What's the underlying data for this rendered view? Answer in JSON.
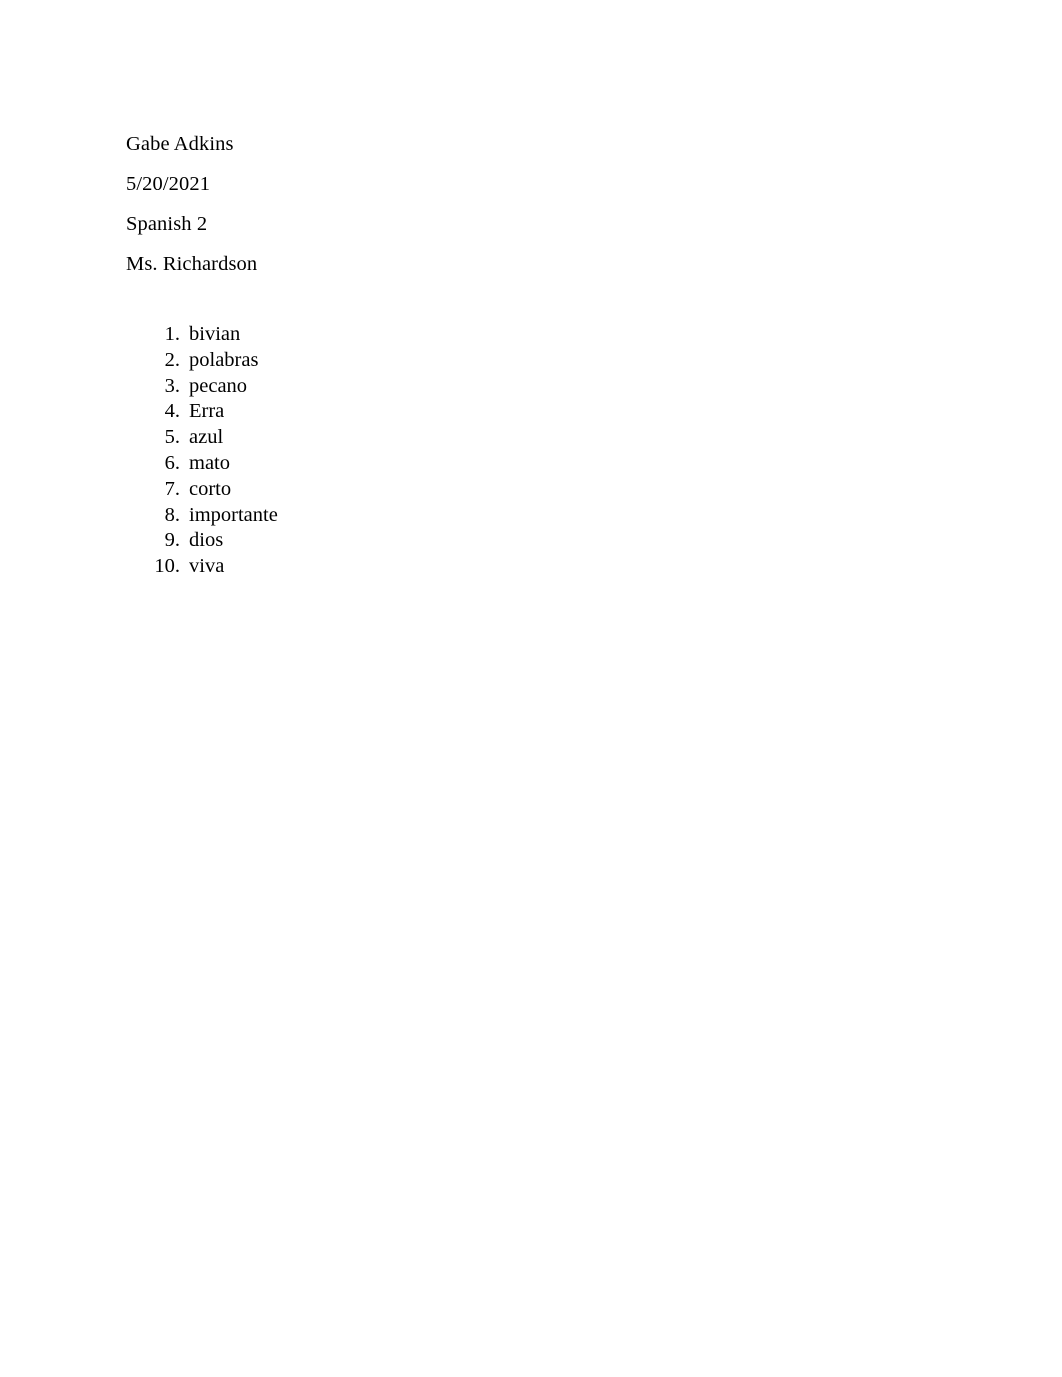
{
  "document": {
    "page_background": "#ffffff",
    "text_color": "#000000",
    "heading": {
      "lines": [
        {
          "text": "Gabe Adkins",
          "role": "student-name"
        },
        {
          "text": "5/20/2021",
          "role": "date"
        },
        {
          "text": "Spanish 2",
          "role": "course"
        },
        {
          "text": "Ms. Richardson",
          "role": "instructor"
        }
      ]
    },
    "word_list": {
      "marker_suffix": ".",
      "items": [
        {
          "number": "1.",
          "word": "bivian"
        },
        {
          "number": "2.",
          "word": "polabras"
        },
        {
          "number": "3.",
          "word": "pecano"
        },
        {
          "number": "4.",
          "word": "Erra"
        },
        {
          "number": "5.",
          "word": "azul"
        },
        {
          "number": "6.",
          "word": "mato"
        },
        {
          "number": "7.",
          "word": "corto"
        },
        {
          "number": "8.",
          "word": "importante"
        },
        {
          "number": "9.",
          "word": "dios"
        },
        {
          "number": "10.",
          "word": "viva"
        }
      ]
    }
  }
}
